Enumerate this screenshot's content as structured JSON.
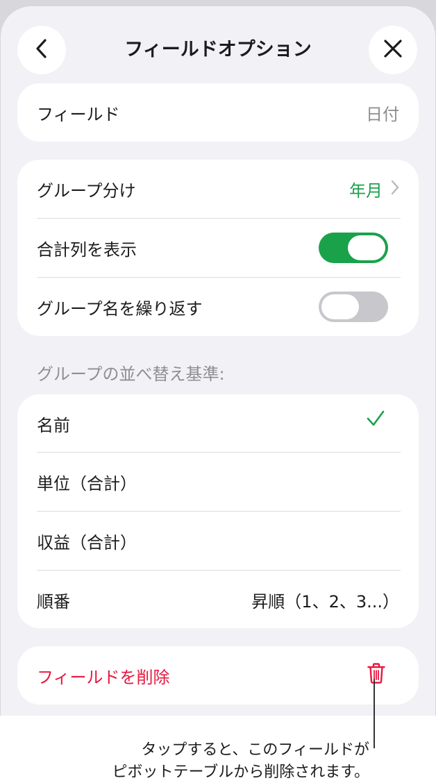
{
  "header": {
    "title": "フィールドオプション"
  },
  "field_row": {
    "label": "フィールド",
    "value": "日付"
  },
  "options": {
    "group_by_label": "グループ分け",
    "group_by_value": "年月",
    "show_totals_label": "合計列を表示",
    "show_totals_on": true,
    "repeat_group_names_label": "グループ名を繰り返す",
    "repeat_group_names_on": false
  },
  "sort": {
    "header": "グループの並べ替え基準:",
    "items": [
      {
        "label": "名前",
        "checked": true
      },
      {
        "label": "単位（合計）"
      },
      {
        "label": "収益（合計）"
      }
    ],
    "order_label": "順番",
    "order_value": "昇順（1、2、3...）"
  },
  "delete": {
    "label": "フィールドを削除"
  },
  "callout": {
    "line1": "タップすると、このフィールドが",
    "line2": "ピボットテーブルから削除されます。"
  },
  "colors": {
    "accent_green": "#1aa24a",
    "destructive_red": "#e8173f",
    "secondary_text": "#8e8e93"
  }
}
